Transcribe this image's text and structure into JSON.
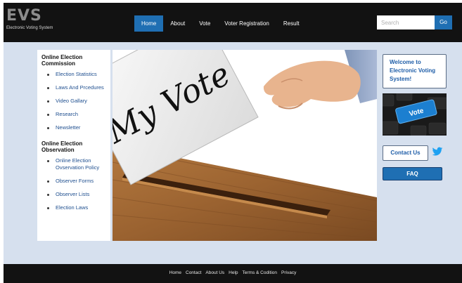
{
  "header": {
    "logo": "EVS",
    "logo_subtitle": "Electronic Voting System",
    "nav": [
      "Home",
      "About",
      "Vote",
      "Voter Registration",
      "Result"
    ],
    "active_nav": "Home",
    "search_placeholder": "Search",
    "go_label": "Go"
  },
  "sidebar": {
    "sections": [
      {
        "title": "Online Election Commission",
        "items": [
          "Election Statistics",
          "Laws And Prcedures",
          "Video Gallary",
          "Research",
          "Newsletter"
        ]
      },
      {
        "title": "Online Election Observation",
        "items": [
          "Online Election Ovservation Policy",
          "Observer Forms",
          "Observer Lists",
          "Election Laws"
        ]
      }
    ]
  },
  "hero": {
    "ballot_text": "My Vote"
  },
  "right": {
    "welcome": "Welcome to Electronic Voting System!",
    "keyboard_key": "Vote",
    "contact": "Contact Us",
    "faq": "FAQ"
  },
  "footer": {
    "links": [
      "Home",
      "Contact",
      "About Us",
      "Help",
      "Terms & Codition",
      "Privacy"
    ]
  },
  "colors": {
    "header_bg": "#121212",
    "accent": "#1f6fb3",
    "page_bg": "#d6e0ee",
    "link": "#1f4f8f"
  },
  "icons": [
    "twitter-icon"
  ]
}
